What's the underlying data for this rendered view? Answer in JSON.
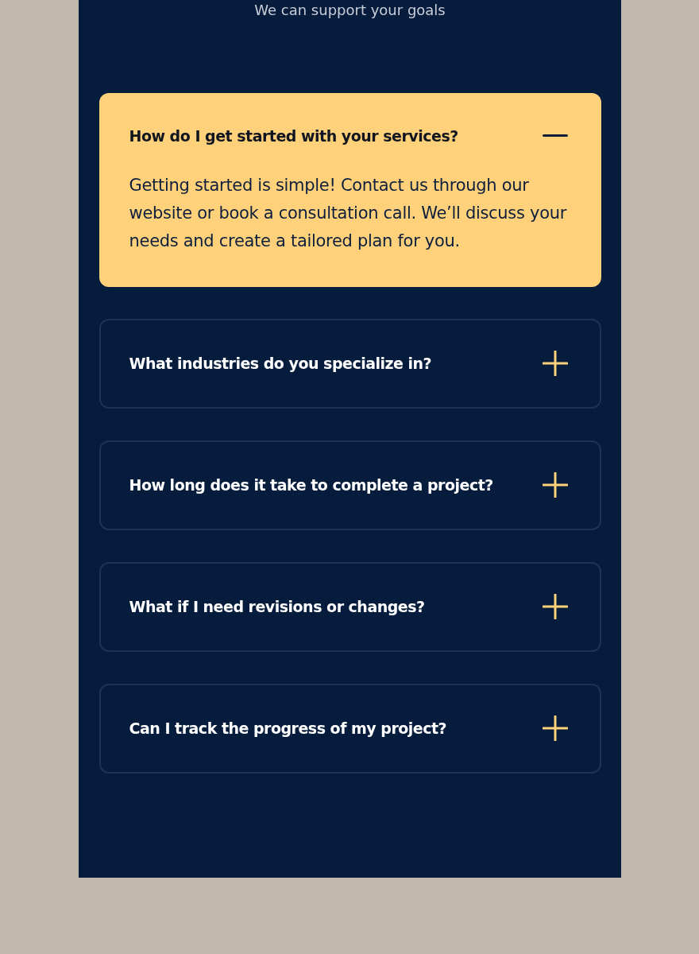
{
  "subtitle": "We can support your goals",
  "faq": [
    {
      "question": "How do I get started with your services?",
      "answer": "Getting started is simple! Contact us through our website or book a consultation call. We’ll discuss your needs and create a tailored plan for you.",
      "expanded": true
    },
    {
      "question": "What industries do you specialize in?",
      "expanded": false
    },
    {
      "question": "How long does it take to complete a project?",
      "expanded": false
    },
    {
      "question": "What if I need revisions or changes?",
      "expanded": false
    },
    {
      "question": "Can I track the progress of my project?",
      "expanded": false
    }
  ]
}
